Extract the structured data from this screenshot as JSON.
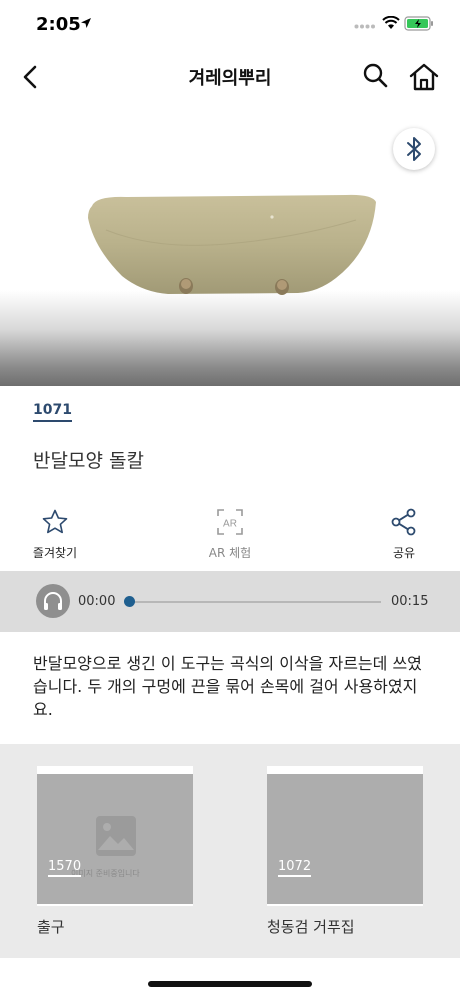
{
  "status": {
    "time": "2:05"
  },
  "nav": {
    "title": "겨레의뿌리"
  },
  "item": {
    "number": "1071",
    "title": "반달모양 돌칼"
  },
  "actions": {
    "favorite": "즐겨찾기",
    "ar": "AR 체험",
    "ar_badge": "AR",
    "share": "공유"
  },
  "audio": {
    "current": "00:00",
    "total": "00:15",
    "progress": 0.0
  },
  "description": "반달모양으로 생긴 이 도구는 곡식의 이삭을 자르는데 쓰였습니다. 두 개의 구멍에 끈을 묶어 손목에 걸어 사용하였지요.",
  "related": [
    {
      "number": "1570",
      "title": "출구",
      "placeholder": "이미지 준비중입니다"
    },
    {
      "number": "1072",
      "title": "청동검 거푸집"
    }
  ],
  "colors": {
    "accent": "#2d4a6e",
    "progress_knob": "#1f5f8f",
    "audio_bg": "#dcdcdc"
  }
}
